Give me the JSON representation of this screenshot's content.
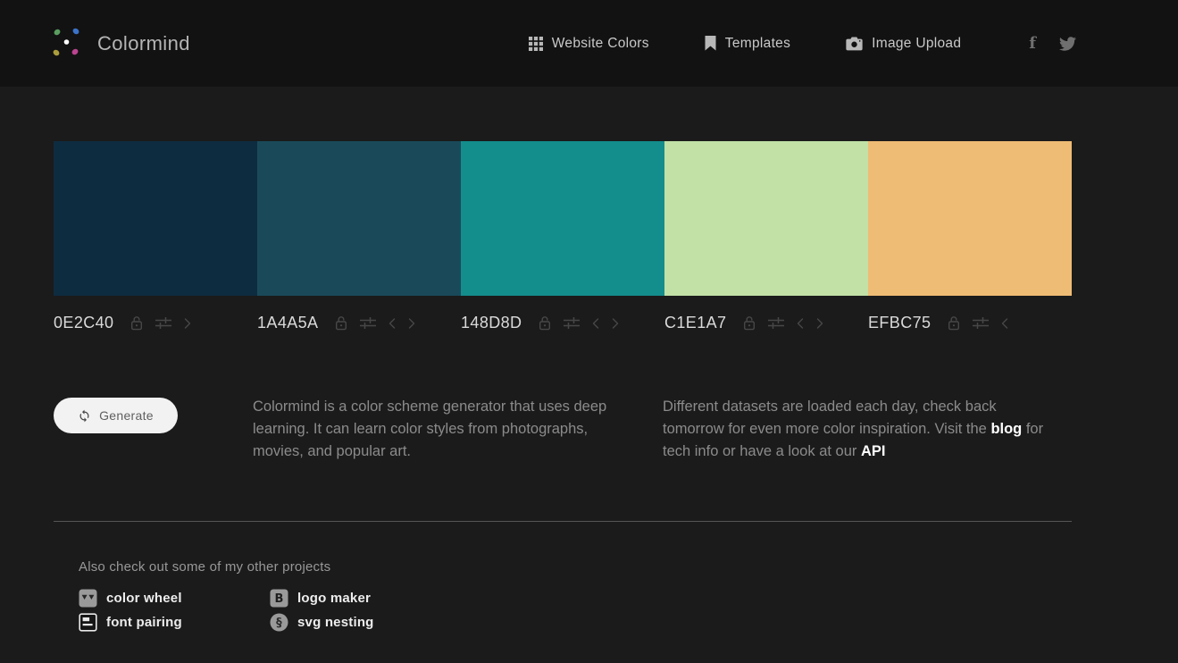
{
  "header": {
    "logo_text": "Colormind",
    "nav": [
      {
        "label": "Website Colors",
        "icon": "grid-icon"
      },
      {
        "label": "Templates",
        "icon": "bookmark-icon"
      },
      {
        "label": "Image Upload",
        "icon": "camera-icon"
      }
    ],
    "social": [
      "facebook-icon",
      "twitter-icon"
    ]
  },
  "palette": {
    "swatches": [
      {
        "hex_label": "0E2C40",
        "color": "#0E2C40",
        "has_left_arrow": false,
        "has_right_arrow": true
      },
      {
        "hex_label": "1A4A5A",
        "color": "#1A4A5A",
        "has_left_arrow": true,
        "has_right_arrow": true
      },
      {
        "hex_label": "148D8D",
        "color": "#148D8D",
        "has_left_arrow": true,
        "has_right_arrow": true
      },
      {
        "hex_label": "C1E1A7",
        "color": "#C1E1A7",
        "has_left_arrow": true,
        "has_right_arrow": true
      },
      {
        "hex_label": "EFBC75",
        "color": "#EFBC75",
        "has_left_arrow": true,
        "has_right_arrow": false
      }
    ],
    "controls_per_swatch": [
      "lock-icon",
      "adjust-sliders-icon",
      "chevron-left-icon",
      "chevron-right-icon"
    ]
  },
  "generate_button": {
    "label": "Generate",
    "icon": "refresh-icon"
  },
  "description": {
    "para1": "Colormind is a color scheme generator that uses deep learning. It can learn color styles from photographs, movies, and popular art.",
    "para2_part1": "Different datasets are loaded each day, check back tomorrow for even more color inspiration. Visit the ",
    "blog_link": "blog",
    "para2_part2": " for tech info or have a look at our ",
    "api_link": "API"
  },
  "footer": {
    "heading": "Also check out some of my other projects",
    "projects": [
      {
        "label": "color wheel",
        "icon": "color-wheel-icon"
      },
      {
        "label": "logo maker",
        "icon": "logo-maker-icon"
      },
      {
        "label": "font pairing",
        "icon": "font-pairing-icon"
      },
      {
        "label": "svg nesting",
        "icon": "svg-nesting-icon"
      }
    ]
  },
  "colors": {
    "header_bg": "#121212",
    "page_bg": "#1b1b1b",
    "hex_label_text": "#dadada",
    "control_icon": "#474747",
    "paragraph_text": "#8b8b8b",
    "link_text": "#ffffff",
    "generate_bg": "#f2f2f2",
    "divider": "#555555"
  }
}
